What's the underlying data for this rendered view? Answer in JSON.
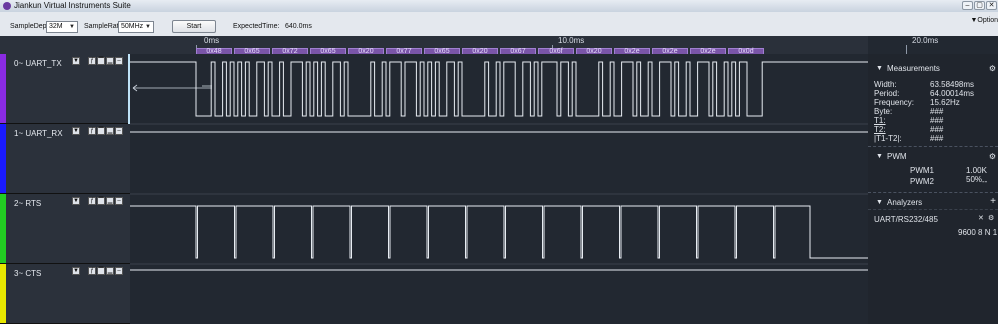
{
  "window": {
    "title": "Jiankun Virtual Instruments Suite",
    "btn_min": "–",
    "btn_max": "▢",
    "btn_close": "✕"
  },
  "toolbar": {
    "sample_depth_label": "SampleDepth",
    "sample_depth_value": "32M",
    "sample_rate_label": "SampleRate",
    "sample_rate_value": "50MHz",
    "start_label": "Start",
    "expected_time_label": "ExpectedTime:",
    "expected_time_value": "640.0ms",
    "options_label": "Option"
  },
  "ruler": {
    "ticks": [
      "0ms",
      "10.0ms",
      "20.0ms"
    ]
  },
  "decode_bytes": [
    "0x48",
    "0x65",
    "0x72",
    "0x65",
    "0x20",
    "0x77",
    "0x65",
    "0x20",
    "0x67",
    "0x6f",
    "0x20",
    "0x2e",
    "0x2e",
    "0x2e",
    "0x0d"
  ],
  "channels": [
    {
      "label": "0~ UART_TX",
      "color": "#8a2be2"
    },
    {
      "label": "1~ UART_RX",
      "color": "#1a1aff"
    },
    {
      "label": "2~ RTS",
      "color": "#22cc22"
    },
    {
      "label": "3~ CTS",
      "color": "#e8e800"
    }
  ],
  "measurements": {
    "title": "Measurements",
    "rows": [
      {
        "k": "Width:",
        "v": "63.58498ms"
      },
      {
        "k": "Period:",
        "v": "64.00014ms"
      },
      {
        "k": "Frequency:",
        "v": "15.62Hz"
      },
      {
        "k": "Byte:",
        "v": "###"
      },
      {
        "k": "T1:",
        "v": "###"
      },
      {
        "k": "T2:",
        "v": "###"
      },
      {
        "k": "|T1-T2|:",
        "v": "###"
      }
    ]
  },
  "pwm": {
    "title": "PWM",
    "rows": [
      {
        "k": "PWM1",
        "v": "1.00K  50%"
      },
      {
        "k": "PWM2",
        "v": "--"
      }
    ]
  },
  "analyzers": {
    "title": "Analyzers",
    "item_name": "UART/RS232/485",
    "item_params": "9600 8 N 1"
  }
}
